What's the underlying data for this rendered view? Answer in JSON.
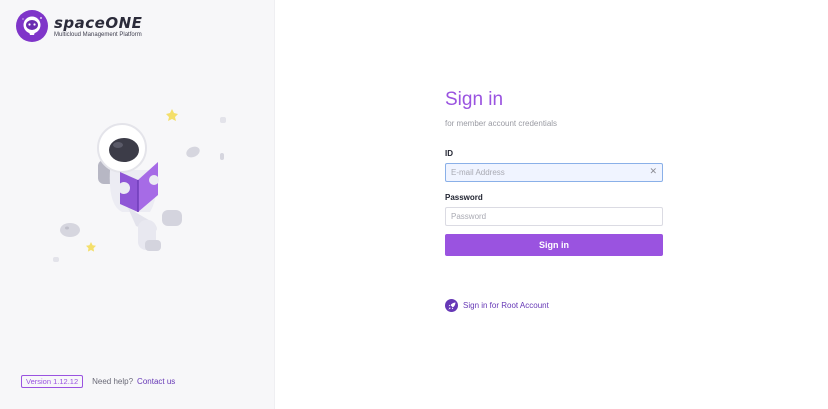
{
  "brand": {
    "name": "spaceONE",
    "tagline": "Multicloud Management Platform",
    "accent_color": "#9a53e0",
    "icon": "astronaut-logo-icon"
  },
  "illustration": {
    "icon": "astronaut-reading-illustration"
  },
  "footer": {
    "version": "Version 1.12.12",
    "help_text": "Need help?",
    "contact_label": "Contact us"
  },
  "signin": {
    "title": "Sign in",
    "subtitle": "for member account credentials",
    "id_label": "ID",
    "id_placeholder": "E-mail Address",
    "id_value": "",
    "clear_icon": "close-icon",
    "password_label": "Password",
    "password_placeholder": "Password",
    "password_value": "",
    "button_label": "Sign in",
    "button_color": "#9a53e0"
  },
  "root_account": {
    "label": "Sign in for Root Account",
    "icon": "rocket-icon",
    "color": "#6638b6"
  }
}
